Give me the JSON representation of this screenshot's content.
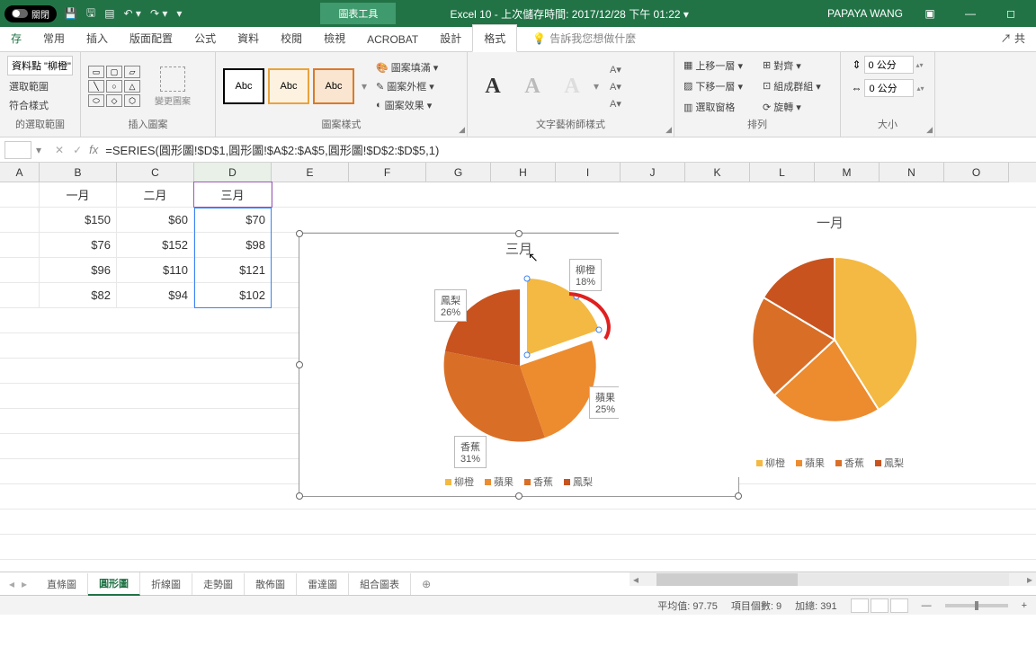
{
  "titlebar": {
    "autosave": "關閉",
    "doc": "Excel 10 - 上次儲存時間: 2017/12/28 下午 01:22 ▾",
    "user": "PAPAYA WANG",
    "tools": "圖表工具"
  },
  "tabs": {
    "file": "存",
    "home": "常用",
    "insert": "插入",
    "layout": "版面配置",
    "formulas": "公式",
    "data": "資料",
    "review": "校閱",
    "view": "檢視",
    "acrobat": "ACROBAT",
    "design": "設計",
    "format": "格式",
    "tellme": "告訴我您想做什麼",
    "share": "共"
  },
  "ribbon": {
    "g1": {
      "dd": "資料點 \"柳橙\"",
      "btn1": "選取範圍",
      "btn2": "符合樣式",
      "label": "的選取範圍"
    },
    "g2": {
      "btn": "變更圖案",
      "label": "插入圖案"
    },
    "g3": {
      "abc": "Abc",
      "fill": "圖案填滿 ▾",
      "outline": "圖案外框 ▾",
      "effects": "圖案效果 ▾",
      "label": "圖案樣式"
    },
    "g4": {
      "label": "文字藝術師樣式"
    },
    "g5": {
      "up": "上移一層 ▾",
      "down": "下移一層 ▾",
      "pane": "選取窗格",
      "align": "對齊 ▾",
      "group": "組成群組 ▾",
      "rotate": "旋轉 ▾",
      "label": "排列"
    },
    "g6": {
      "h": "0 公分",
      "w": "0 公分",
      "label": "大小"
    }
  },
  "formula": "=SERIES(圓形圖!$D$1,圓形圖!$A$2:$A$5,圓形圖!$D$2:$D$5,1)",
  "cols": [
    "A",
    "B",
    "C",
    "D",
    "E",
    "F",
    "G",
    "H",
    "I",
    "J",
    "K",
    "L",
    "M",
    "N",
    "O"
  ],
  "table": {
    "headers": [
      "一月",
      "二月",
      "三月"
    ],
    "rows": [
      [
        "$150",
        "$60",
        "$70"
      ],
      [
        "$76",
        "$152",
        "$98"
      ],
      [
        "$96",
        "$110",
        "$121"
      ],
      [
        "$82",
        "$94",
        "$102"
      ]
    ]
  },
  "chart_data": [
    {
      "type": "pie",
      "title": "三月",
      "categories": [
        "柳橙",
        "蘋果",
        "香蕉",
        "鳳梨"
      ],
      "values": [
        70,
        98,
        121,
        102
      ],
      "percents": [
        18,
        25,
        31,
        26
      ],
      "colors": [
        "#f4b942",
        "#ed8b2f",
        "#d96f27",
        "#c8531e"
      ],
      "datalabels": [
        {
          "name": "柳橙",
          "pct": "18%"
        },
        {
          "name": "蘋果",
          "pct": "25%"
        },
        {
          "name": "香蕉",
          "pct": "31%"
        },
        {
          "name": "鳳梨",
          "pct": "26%"
        }
      ]
    },
    {
      "type": "pie",
      "title": "一月",
      "categories": [
        "柳橙",
        "蘋果",
        "香蕉",
        "鳳梨"
      ],
      "values": [
        150,
        76,
        96,
        82
      ],
      "colors": [
        "#f4b942",
        "#ed8b2f",
        "#d96f27",
        "#c8531e"
      ]
    }
  ],
  "legend": [
    "柳橙",
    "蘋果",
    "香蕉",
    "鳳梨"
  ],
  "sheets": [
    "直條圖",
    "圓形圖",
    "折線圖",
    "走勢圖",
    "散佈圖",
    "雷達圖",
    "組合圖表"
  ],
  "active_sheet": "圓形圖",
  "statusbar": {
    "avg": "平均值: 97.75",
    "count": "項目個數: 9",
    "sum": "加總: 391",
    "zoom": "+"
  }
}
